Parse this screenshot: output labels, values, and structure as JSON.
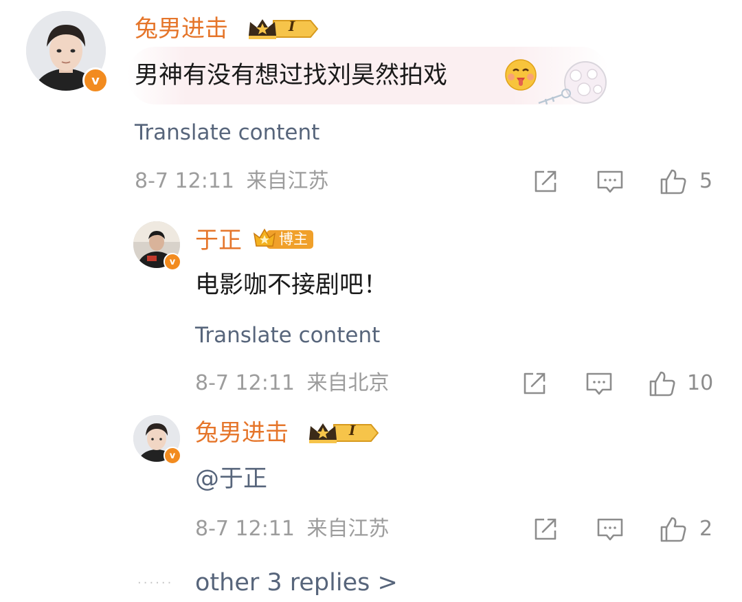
{
  "comments": [
    {
      "username": "兔男进击",
      "badge_level": "I",
      "text": "男神有没有想过找刘昊然拍戏",
      "translate_label": "Translate content",
      "date": "8-7 12:11",
      "location": "来自江苏",
      "likes": "5"
    },
    {
      "username": "于正",
      "badge_label": "博主",
      "text": "电影咖不接剧吧！",
      "translate_label": "Translate content",
      "date": "8-7 12:11",
      "location": "来自北京",
      "likes": "10"
    },
    {
      "username": "兔男进击",
      "badge_level": "I",
      "text": "@于正",
      "date": "8-7 12:11",
      "location": "来自江苏",
      "likes": "2"
    }
  ],
  "more_replies": "other 3 replies >",
  "verified_mark": "v",
  "icons": [
    "repost-icon",
    "comment-icon",
    "like-icon"
  ],
  "colors": {
    "username": "#e5752a",
    "link": "#57657b",
    "meta": "#9c9c9c",
    "verified": "#f28b1f"
  }
}
